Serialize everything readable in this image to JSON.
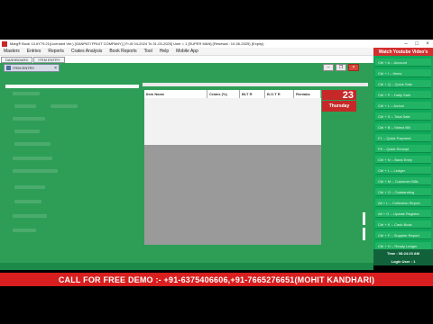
{
  "window": {
    "title": "Marg® Book 13.#Y79.21(Licensed Ver.) [GANPATI FRUIT COMPANY] [ Fr-i5 04-2024 To 31-03-2025] User = 1 [SUPER MAN] (Renewal : 10-06-2025) (Expiry)"
  },
  "menu": [
    "Masters",
    "Entries",
    "Reports",
    "Crates Analysis",
    "Book Reports",
    "Tool",
    "Help",
    "Mobile App"
  ],
  "tabs": [
    "DASHBOARD",
    "ITEM ENTRY"
  ],
  "subwindow": {
    "label": "ITEM ENTRY"
  },
  "grid": {
    "columns": [
      "Item Name",
      "Crates (%)",
      "BLT R",
      "B.O.T R",
      "Rentaka"
    ]
  },
  "date": {
    "day": "23",
    "weekday": "Thursday"
  },
  "sidebar": {
    "header": "Watch Youtube Video's",
    "items": [
      "Ctrl + A :- Account",
      "Ctrl + I :- Items",
      "Ctrl + Q :- Quick Sale",
      "Ctrl + P :- Daily Sale",
      "Ctrl + L :- Arrival",
      "Ctrl + S :- Total Sale",
      "Ctrl + B :- Select Bill",
      "F1 :- Quick Payment",
      "F8 :- Quick Receipt",
      "Ctrl + N :- Bank Entry",
      "Ctrl + L :- Ledger",
      "Ctrl + M :- Customer Bills",
      "Ctrl + O :- Outstanding",
      "Alt + L :- Collection Report",
      "Alt + G :- Update Register",
      "Ctrl + K :- Cash Book",
      "Ctrl + F :- Supplier Report",
      "Ctrl + H :- Ready Ledger"
    ],
    "time": "Time : 08:24:23 AM",
    "login": "Login User : 1"
  },
  "banner": "CALL FOR FREE DEMO :- +91-6375406606,+91-7665276651(MOHIT KANDHARI)"
}
